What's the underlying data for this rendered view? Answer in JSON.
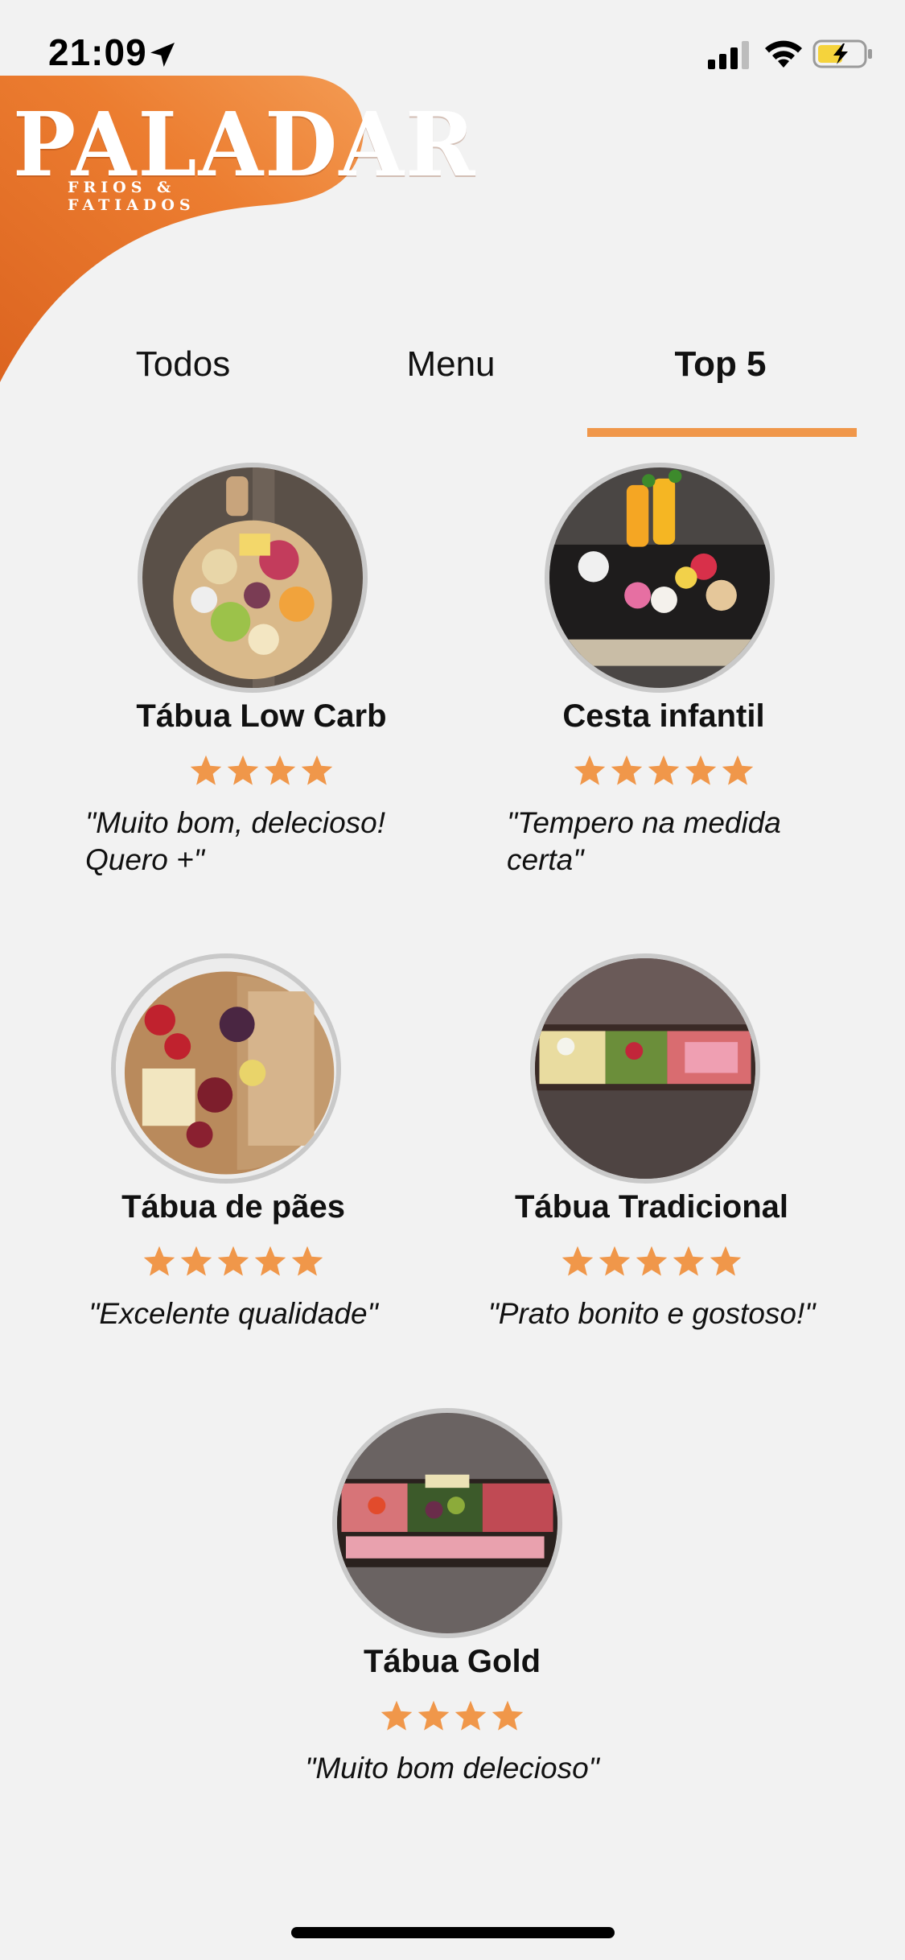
{
  "status_bar": {
    "time": "21:09",
    "icons": [
      "location-arrow-icon",
      "cellular-signal-icon",
      "wifi-icon",
      "battery-charging-icon"
    ]
  },
  "header": {
    "logo_title": "PALADAR",
    "logo_subtitle": "FRIOS & FATIADOS",
    "brand_color": "#e8752c"
  },
  "tabs": [
    {
      "label": "Todos",
      "active": false
    },
    {
      "label": "Menu",
      "active": false
    },
    {
      "label": "Top 5",
      "active": true
    }
  ],
  "accent_color": "#f0974a",
  "products": [
    {
      "name": "Tábua Low Carb",
      "rating": 4,
      "review": "\"Muito bom, delecioso! Quero +\""
    },
    {
      "name": "Cesta infantil",
      "rating": 5,
      "review": "\"Tempero na medida certa\""
    },
    {
      "name": "Tábua de pães",
      "rating": 5,
      "review": "\"Excelente qualidade\""
    },
    {
      "name": "Tábua Tradicional",
      "rating": 5,
      "review": "\"Prato bonito e gostoso!\""
    },
    {
      "name": "Tábua Gold",
      "rating": 4,
      "review": "\"Muito bom delecioso\""
    }
  ]
}
